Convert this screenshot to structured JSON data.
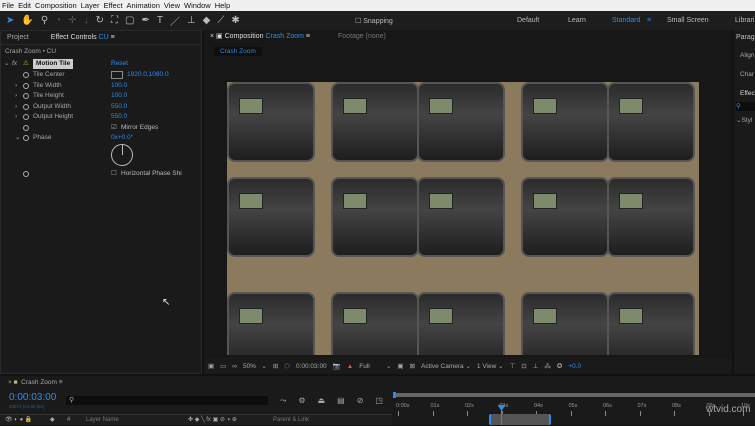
{
  "menu": [
    "File",
    "Edit",
    "Composition",
    "Layer",
    "Effect",
    "Animation",
    "View",
    "Window",
    "Help"
  ],
  "toolbar": {
    "snapping": "Snapping",
    "workspaces": [
      "Default",
      "Learn",
      "Standard",
      "Small Screen",
      "Librari"
    ]
  },
  "left_panel": {
    "tab_project": "Project",
    "tab_effect_controls": "Effect Controls",
    "effect_layer": "CU",
    "breadcrumb": "Crash Zoom • CU",
    "effect_name": "Motion Tile",
    "reset": "Reset",
    "props": [
      {
        "label": "Tile Center",
        "value": "1920.0,1080.0"
      },
      {
        "label": "Tile Width",
        "value": "100.0"
      },
      {
        "label": "Tile Height",
        "value": "100.0"
      },
      {
        "label": "Output Width",
        "value": "550.0"
      },
      {
        "label": "Output Height",
        "value": "550.0"
      }
    ],
    "mirror_edges": "Mirror Edges",
    "mirror_edges_checked": true,
    "phase_label": "Phase",
    "phase_value": "0x+0.0°",
    "horizontal_phase": "Horizontal Phase Shi",
    "horizontal_phase_checked": false
  },
  "comp_panel": {
    "tab_label": "Composition",
    "comp_name": "Crash Zoom",
    "footage_tab": "Footage (none)",
    "sub_tab": "Crash Zoom"
  },
  "viewer_bar": {
    "zoom": "50%",
    "timecode": "0:00:03:00",
    "resolution": "Full",
    "camera": "Active Camera",
    "views": "1 View",
    "exposure": "+0.0"
  },
  "right_panel": {
    "items": [
      "Parag",
      "Align",
      "Char",
      "Effec",
      "Styl"
    ]
  },
  "timeline": {
    "comp_tab": "Crash Zoom",
    "timecode": "0:00:03:00",
    "frames": "00072 (24.00 fps)",
    "col_layer_name": "Layer Name",
    "col_parent": "Parent & Link",
    "col_num": "#",
    "ticks": [
      "0:00s",
      "01s",
      "02s",
      "03s",
      "04s",
      "05s",
      "06s",
      "07s",
      "08s",
      "09s",
      "10s"
    ],
    "playhead_seconds": 3,
    "work_area_seconds": [
      2.7,
      4.5
    ]
  },
  "watermark": "wtvid.com"
}
